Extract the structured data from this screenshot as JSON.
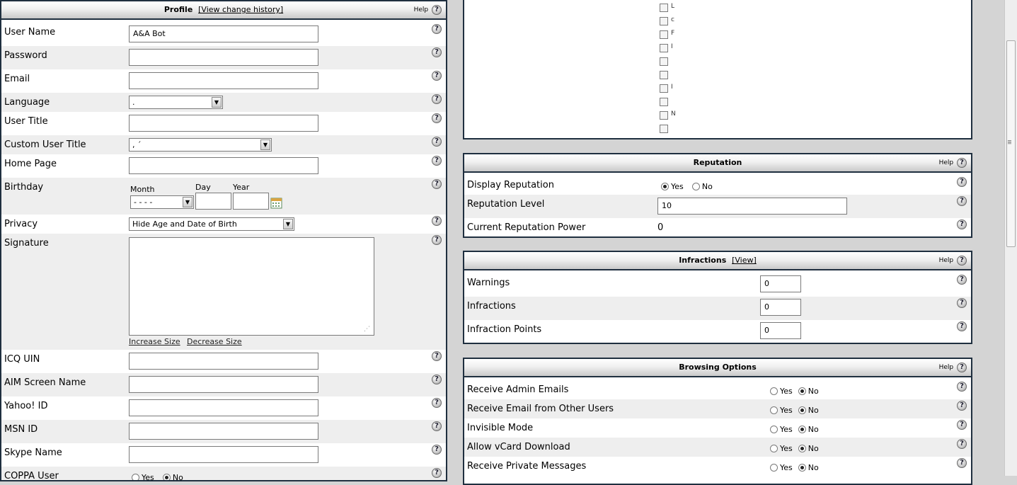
{
  "profile": {
    "title": "Profile",
    "history_link": "[View change history]",
    "help": "Help",
    "help_icon": "?",
    "fields": {
      "username": {
        "label": "User Name",
        "value": "A&A Bot"
      },
      "password": {
        "label": "Password",
        "value": ""
      },
      "email": {
        "label": "Email",
        "value": ""
      },
      "language": {
        "label": "Language",
        "value": "."
      },
      "user_title": {
        "label": "User Title",
        "value": ""
      },
      "custom_user_title": {
        "label": "Custom User Title",
        "value": ",                         ´"
      },
      "home_page": {
        "label": "Home Page",
        "value": ""
      },
      "birthday": {
        "label": "Birthday",
        "month_label": "Month",
        "day_label": "Day",
        "year_label": "Year",
        "month_value": "- - - -",
        "day_value": "",
        "year_value": ""
      },
      "privacy": {
        "label": "Privacy",
        "value": "Hide Age and Date of Birth"
      },
      "signature": {
        "label": "Signature",
        "value": "",
        "increase": "Increase Size",
        "decrease": "Decrease Size"
      },
      "icq": {
        "label": "ICQ UIN",
        "value": ""
      },
      "aim": {
        "label": "AIM Screen Name",
        "value": ""
      },
      "yahoo": {
        "label": "Yahoo! ID",
        "value": ""
      },
      "msn": {
        "label": "MSN ID",
        "value": ""
      },
      "skype": {
        "label": "Skype Name",
        "value": ""
      },
      "coppa": {
        "label": "COPPA User",
        "yes": "Yes",
        "no": "No",
        "selected": "No"
      }
    }
  },
  "reputation": {
    "title": "Reputation",
    "help": "Help",
    "display": {
      "label": "Display Reputation",
      "yes": "Yes",
      "no": "No",
      "selected": "Yes"
    },
    "level": {
      "label": "Reputation Level",
      "value": "10"
    },
    "power": {
      "label": "Current Reputation Power",
      "value": "0"
    }
  },
  "infractions": {
    "title": "Infractions",
    "view_link": "[View]",
    "help": "Help",
    "warnings": {
      "label": "Warnings",
      "value": "0"
    },
    "infractions": {
      "label": "Infractions",
      "value": "0"
    },
    "points": {
      "label": "Infraction Points",
      "value": "0"
    }
  },
  "browsing": {
    "title": "Browsing Options",
    "help": "Help",
    "yes": "Yes",
    "no": "No",
    "options": [
      {
        "label": "Receive Admin Emails",
        "selected": "No"
      },
      {
        "label": "Receive Email from Other Users",
        "selected": "No"
      },
      {
        "label": "Invisible Mode",
        "selected": "No"
      },
      {
        "label": "Allow vCard Download",
        "selected": "No"
      },
      {
        "label": "Receive Private Messages",
        "selected": "No"
      }
    ]
  },
  "usergroups": {
    "items": [
      "L",
      "c",
      "F",
      "I",
      "",
      "",
      "I",
      "",
      "N",
      ""
    ]
  },
  "colors": {
    "panel_border": "#1f2f3f",
    "alt_row": "#eeeeee",
    "background": "#d4d4d4"
  }
}
